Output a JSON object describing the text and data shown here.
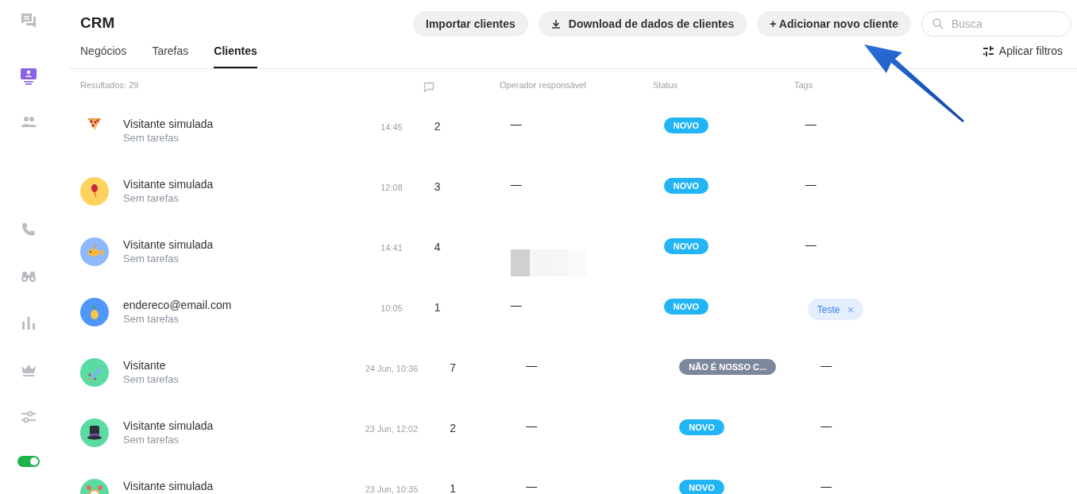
{
  "sidebar": {
    "items": [
      {
        "selected": false
      },
      {
        "selected": true
      },
      {
        "selected": false
      },
      {
        "selected": false
      },
      {
        "selected": false
      },
      {
        "selected": false
      },
      {
        "selected": false
      },
      {
        "selected": false
      }
    ],
    "toggle": {
      "on": true
    }
  },
  "header": {
    "title": "CRM",
    "buttons": [
      {
        "label": "Importar clientes",
        "kind": "plain"
      },
      {
        "label": "Download de dados de clientes",
        "kind": "download"
      },
      {
        "label": "+ Adicionar novo cliente",
        "kind": "plain"
      }
    ],
    "search": {
      "placeholder": "Busca"
    }
  },
  "tabs": [
    {
      "label": "Negócios",
      "selected": false
    },
    {
      "label": "Tarefas",
      "selected": false
    },
    {
      "label": "Clientes",
      "selected": true
    }
  ],
  "filter_button": {
    "label": "Aplicar filtros"
  },
  "table": {
    "results": "Resultados: 29",
    "columns": [
      {
        "kind": "comments-icon"
      },
      {
        "kind": "text",
        "label": "Operador responsável"
      },
      {
        "kind": "text",
        "label": "Status"
      },
      {
        "kind": "text",
        "label": "Tags"
      }
    ],
    "rows": [
      {
        "name": "Visitante simulada",
        "subtitle": "Sem tarefas",
        "time": "14:45",
        "count": "2",
        "operator_hidden": false,
        "operator": "—",
        "status": {
          "label": "NOVO",
          "color": "#22b5f6"
        },
        "no_tags": "—"
      },
      {
        "name": "Visitante simulada",
        "subtitle": "Sem tarefas",
        "time": "12:08",
        "count": "3",
        "color": "#ffd25e",
        "operator_hidden": false,
        "operator": "—",
        "status": {
          "label": "NOVO",
          "color": "#22b5f6"
        },
        "no_tags": "—"
      },
      {
        "name": "Visitante simulada",
        "subtitle": "Sem tarefas",
        "time": "14:41",
        "count": "4",
        "color": "#8cb9fb",
        "operator_hidden": true,
        "status": {
          "label": "NOVO",
          "color": "#22b5f6"
        },
        "no_tags": "—"
      },
      {
        "name": "endereco@email.com",
        "subtitle": "Sem tarefas",
        "time": "10:05",
        "count": "1",
        "color": "#4f97fb",
        "operator_hidden": false,
        "operator": "—",
        "status": {
          "label": "NOVO",
          "color": "#22b5f6"
        },
        "tags": [
          {
            "label": "Teste"
          }
        ]
      },
      {
        "name": "Visitante",
        "subtitle": "Sem tarefas",
        "time": "24 Jun, 10:36",
        "count": "7",
        "color": "#5adba2",
        "operator_hidden": false,
        "operator": "—",
        "status": {
          "label": "NÃO É NOSSO C...",
          "color": "#7b879b"
        },
        "no_tags": "—"
      },
      {
        "name": "Visitante simulada",
        "subtitle": "Sem tarefas",
        "time": "23 Jun, 12:02",
        "count": "2",
        "color": "#5adba2",
        "operator_hidden": false,
        "operator": "—",
        "status": {
          "label": "NOVO",
          "color": "#22b5f6"
        },
        "no_tags": "—"
      },
      {
        "name": "Visitante simulada",
        "time": "23 Jun, 10:35",
        "count": "1",
        "color": "#5adba2",
        "operator_hidden": false,
        "operator": "—",
        "status": {
          "label": "NOVO",
          "color": "#22b5f6"
        },
        "no_tags": "—"
      }
    ]
  }
}
